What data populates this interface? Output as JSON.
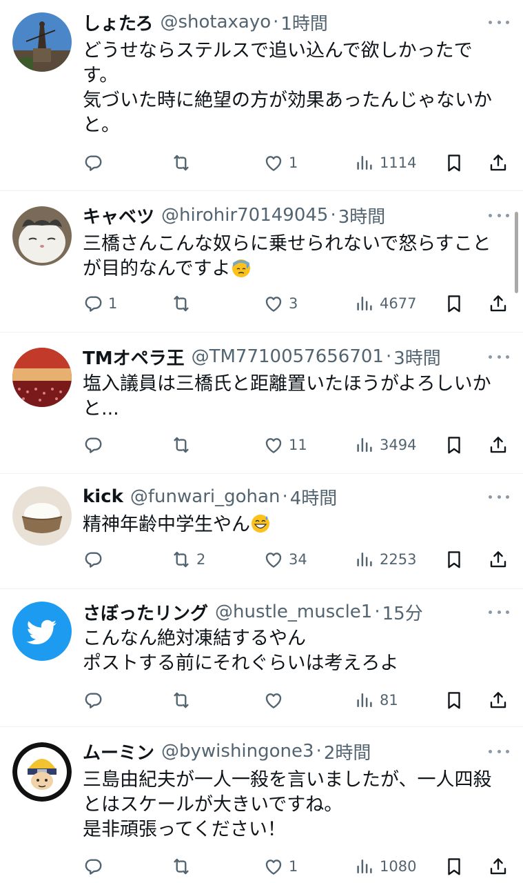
{
  "tweets": [
    {
      "name": "しょたろ",
      "handle": "@shotaxayo",
      "separator": "·",
      "time": "1時間",
      "lines": [
        "どうせならステルスで追い込んで欲しかったで",
        "す。",
        "気づいた時に絶望の方が効果あったんじゃないか",
        "と。"
      ],
      "reply_count": "",
      "repost_count": "",
      "like_count": "1",
      "view_count": "1114"
    },
    {
      "name": "キャベツ",
      "handle": "@hirohir70149045",
      "separator": "·",
      "time": "3時間",
      "lines": [
        "三橋さんこんな奴らに乗せられないで怒らすこと",
        "が目的なんですよ"
      ],
      "reply_count": "1",
      "repost_count": "",
      "like_count": "3",
      "view_count": "4677"
    },
    {
      "name": "TMオペラ王",
      "handle": "@TM7710057656701",
      "separator": "·",
      "time": "3時間",
      "lines": [
        "塩入議員は三橋氏と距離置いたほうがよろしいか",
        "と..."
      ],
      "reply_count": "",
      "repost_count": "",
      "like_count": "11",
      "view_count": "3494"
    },
    {
      "name": "kick",
      "handle": "@funwari_gohan",
      "separator": "·",
      "time": "4時間",
      "lines": [
        "精神年齢中学生やん"
      ],
      "reply_count": "",
      "repost_count": "2",
      "like_count": "34",
      "view_count": "2253"
    },
    {
      "name": "さぼったリング",
      "handle": "@hustle_muscle1",
      "separator": "·",
      "time": "15分",
      "lines": [
        "こんなん絶対凍結するやん",
        "ポストする前にそれぐらいは考えろよ"
      ],
      "reply_count": "",
      "repost_count": "",
      "like_count": "",
      "view_count": "81"
    },
    {
      "name": "ムーミン",
      "handle": "@bywishingone3",
      "separator": "·",
      "time": "2時間",
      "lines": [
        "三島由紀夫が一人一殺を言いましたが、一人四殺",
        "とはスケールが大きいですね。",
        "是非頑張ってください！"
      ],
      "reply_count": "",
      "repost_count": "",
      "like_count": "1",
      "view_count": "1080"
    }
  ],
  "icons": {
    "reply": "reply-icon",
    "repost": "repost-icon",
    "like": "heart-icon",
    "views": "views-icon",
    "bookmark": "bookmark-icon",
    "share": "share-icon",
    "more": "more-icon"
  },
  "colors": {
    "text": "#0f1419",
    "muted": "#536471",
    "divider": "#eff3f4",
    "twitter_blue": "#1d9bf0"
  }
}
